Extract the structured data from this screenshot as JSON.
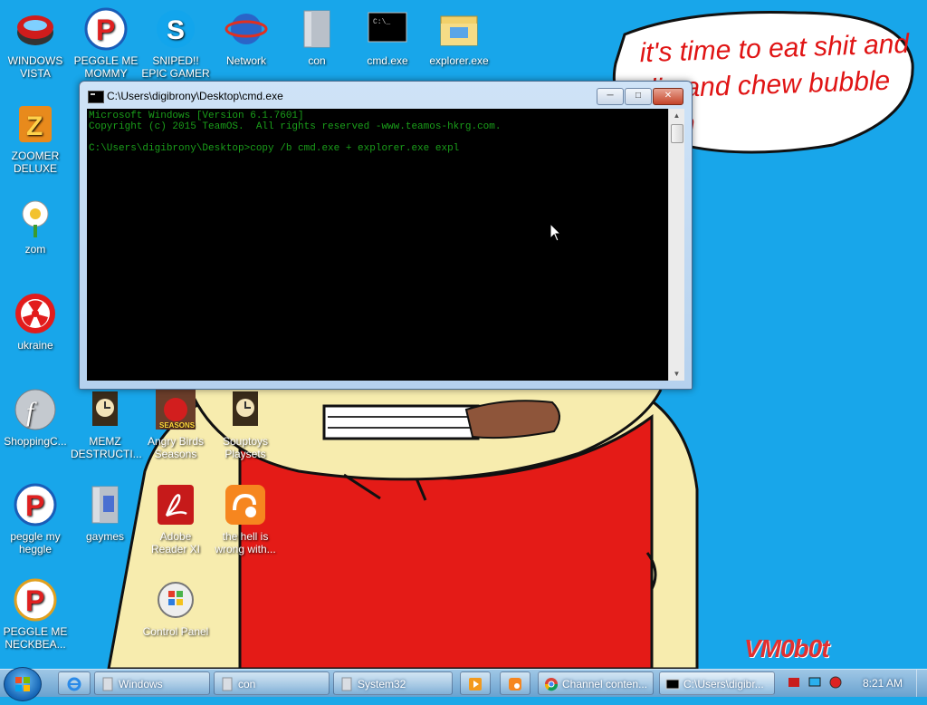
{
  "wallpaper": {
    "bubble_text": "it's time to eat shit and die and chew bubble gum",
    "signature": "VM0b0t"
  },
  "desktop_icons": [
    {
      "id": "windows-vista",
      "label": "WINDOWS VISTA",
      "icon": "red-helmet-icon"
    },
    {
      "id": "peggle-me-mommy",
      "label": "PEGGLE ME MOMMY",
      "icon": "peggle-p-icon"
    },
    {
      "id": "sniped",
      "label": "SNIPED!! EPIC GAMER 360...",
      "icon": "skype-icon"
    },
    {
      "id": "network",
      "label": "Network",
      "icon": "network-globe-icon"
    },
    {
      "id": "con",
      "label": "con",
      "icon": "folder-icon"
    },
    {
      "id": "cmd-exe",
      "label": "cmd.exe",
      "icon": "cmd-icon"
    },
    {
      "id": "explorer-exe",
      "label": "explorer.exe",
      "icon": "explorer-folder-icon"
    },
    {
      "id": "zoomer-deluxe",
      "label": "ZOOMER DELUXE",
      "icon": "zuma-icon"
    },
    {
      "id": "zom",
      "label": "zom",
      "icon": "flower-icon"
    },
    {
      "id": "ukraine",
      "label": "ukraine",
      "icon": "radiation-icon"
    },
    {
      "id": "shopping",
      "label": "ShoppingC...",
      "icon": "flash-icon"
    },
    {
      "id": "memz",
      "label": "MEMZ DESTRUCTI...",
      "icon": "clock-doc-icon"
    },
    {
      "id": "angry-birds",
      "label": "Angry Birds Seasons",
      "icon": "angry-birds-icon"
    },
    {
      "id": "souptoys",
      "label": "Souptoys Playsets",
      "icon": "clock-doc-icon"
    },
    {
      "id": "peggle-my-heggle",
      "label": "peggle my heggle",
      "icon": "peggle-p-icon"
    },
    {
      "id": "gaymes",
      "label": "gaymes",
      "icon": "folder-icon"
    },
    {
      "id": "adobe-reader",
      "label": "Adobe Reader XI",
      "icon": "adobe-icon"
    },
    {
      "id": "the-hell",
      "label": "the hell is wrong with...",
      "icon": "uc-browser-icon"
    },
    {
      "id": "peggle-me-neckbea",
      "label": "PEGGLE ME NECKBEA...",
      "icon": "peggle-p-icon"
    },
    {
      "id": "control-panel",
      "label": "Control Panel",
      "icon": "control-panel-icon"
    }
  ],
  "cmd_window": {
    "title": "C:\\Users\\digibrony\\Desktop\\cmd.exe",
    "lines": [
      "Microsoft Windows [Version 6.1.7601]",
      "Copyright (c) 2015 TeamOS.  All rights reserved -www.teamos-hkrg.com.",
      "",
      "C:\\Users\\digibrony\\Desktop>copy /b cmd.exe + explorer.exe expl"
    ],
    "text_color": "#1a9e1a"
  },
  "taskbar": {
    "items": [
      {
        "label": "Windows",
        "icon": "folder-icon"
      },
      {
        "label": "con",
        "icon": "folder-icon"
      },
      {
        "label": "System32",
        "icon": "folder-icon"
      },
      {
        "label": "Channel conten...",
        "icon": "chrome-icon"
      },
      {
        "label": "C:\\Users\\digibr...",
        "icon": "cmd-icon"
      }
    ],
    "clock": "8:21 AM"
  }
}
